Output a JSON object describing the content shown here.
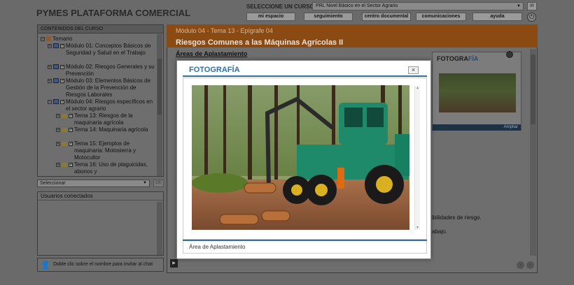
{
  "app_title": "PYMES PLATAFORMA COMERCIAL",
  "course_selector": {
    "label": "SELECCIONE UN CURSO:",
    "value": "PRL Nivel Básico en el Sector Agrario",
    "go_label": "IR"
  },
  "nav": [
    "mi espacio",
    "seguimiento",
    "centro documental",
    "comunicaciones",
    "ayuda"
  ],
  "sidebar": {
    "header": "CONTENIDOS DEL CURSO",
    "tree": [
      {
        "text": "Temario"
      },
      {
        "text": "Módulo 01: Conceptos Básicos de Seguridad y Salud en el Trabajo"
      },
      {
        "text": "Módulo 02: Riesgos Generales y su Prevención"
      },
      {
        "text": "Módulo 03: Elementos Básicos de Gestión de la Prevención de Riesgos Laborales"
      },
      {
        "text": "Módulo 04: Riesgos específicos en el sector agrario"
      },
      {
        "text": "Tema 13: Riesgos de la maquinaria agrícola"
      },
      {
        "text": "Tema 14: Maquinaria agrícola"
      },
      {
        "text": "Tema 15: Ejemplos de maquinaria: Motosierra y Motocultor"
      },
      {
        "text": "Tema 16: Uso de plaguicidas, abonos y"
      }
    ],
    "select_placeholder": "Seleccionar",
    "ok_label": "OK"
  },
  "users": {
    "header": "Usuarios conectados",
    "chat_hint": "Doble clic sobre el nombre para invitar al chat"
  },
  "content": {
    "crumb": "Módulo 04 - Tema 13 - Epígrafe 04",
    "title": "Riesgos Comunes a las Máquinas Agrícolas II",
    "section": "Áreas de Aplastamiento",
    "thumb_logo_a": "FOTOGRA",
    "thumb_logo_b": "FÍA",
    "thumb_ampliar": "Ampliar",
    "text_fragments": [
      "ibilidades de riesgo.",
      "abajo."
    ]
  },
  "modal": {
    "logo_a": "FOTOGRA",
    "logo_b": "FÍA",
    "close": "×",
    "caption": "Área de Aplastamiento"
  }
}
